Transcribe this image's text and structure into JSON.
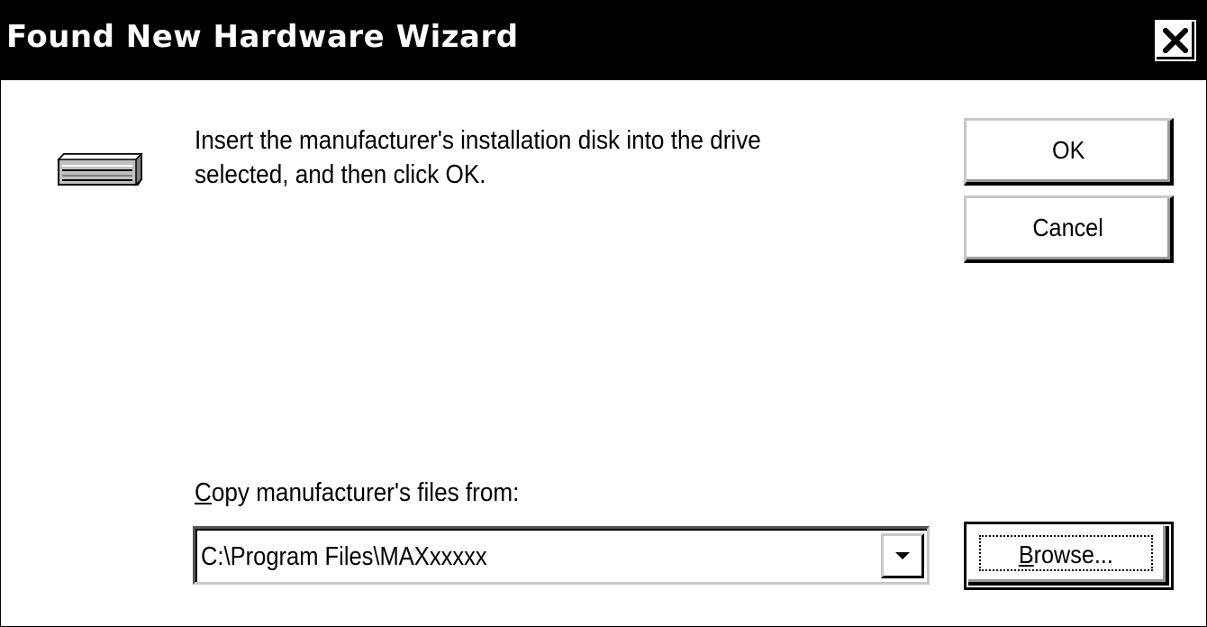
{
  "window": {
    "title": "Found New Hardware Wizard",
    "close_symbol": "×"
  },
  "icons": {
    "drive": "disk-drive-icon",
    "close": "close-icon",
    "dropdown": "chevron-down-icon"
  },
  "message": {
    "line1": "Insert the manufacturer's installation disk into the drive",
    "line2": "selected, and then click OK."
  },
  "buttons": {
    "ok_label": "OK",
    "cancel_label": "Cancel",
    "browse_label": "Browse..."
  },
  "copy_from": {
    "label": "Copy manufacturer's files from:",
    "accelerator": "C",
    "value": "C:\\Program Files\\MAXxxxxx"
  },
  "colors": {
    "titlebar_bg": "#000000",
    "titlebar_text": "#ffffff",
    "dialog_bg": "#ffffff"
  }
}
